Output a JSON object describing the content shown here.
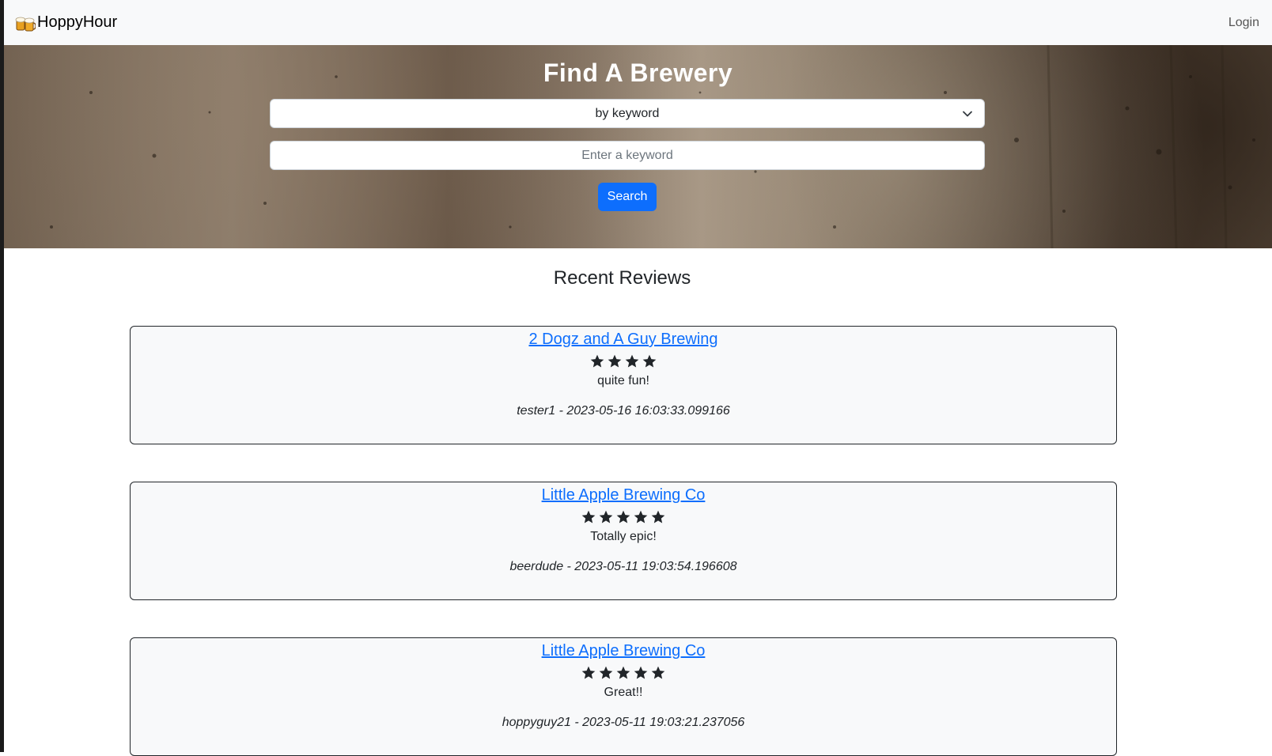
{
  "navbar": {
    "brand": "HoppyHour",
    "login_label": "Login"
  },
  "hero": {
    "title": "Find A Brewery",
    "search_by_selected": "by keyword",
    "keyword_placeholder": "Enter a keyword",
    "search_button": "Search"
  },
  "reviews_section": {
    "title": "Recent Reviews",
    "reviews": [
      {
        "brewery": "2 Dogz and A Guy Brewing",
        "rating": 4,
        "text": "quite fun!",
        "meta": "tester1 - 2023-05-16 16:03:33.099166"
      },
      {
        "brewery": "Little Apple Brewing Co",
        "rating": 5,
        "text": "Totally epic!",
        "meta": "beerdude - 2023-05-11 19:03:54.196608"
      },
      {
        "brewery": "Little Apple Brewing Co",
        "rating": 5,
        "text": "Great!!",
        "meta": "hoppyguy21 - 2023-05-11 19:03:21.237056"
      }
    ]
  },
  "colors": {
    "primary": "#0d6efd",
    "navbar_bg": "#f8f9fa",
    "card_bg": "#f8f9fa",
    "text": "#212529"
  },
  "icons": {
    "brand": "beer-mugs-icon",
    "select": "chevron-down-icon",
    "rating": "star-icon"
  }
}
